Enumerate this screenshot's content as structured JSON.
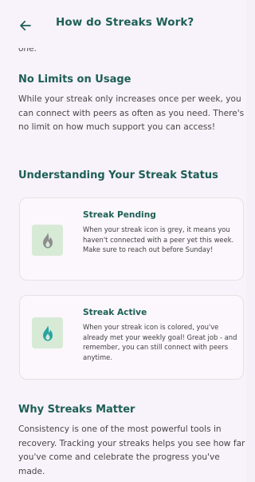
{
  "header": {
    "title": "How do Streaks Work?",
    "back_icon": "arrow-left-icon"
  },
  "content": {
    "cut_text": "one.",
    "sections": [
      {
        "title": "No Limits on Usage",
        "body": "While your streak only increases once per week, you can connect with peers as often as you need. There's no limit on how much support you can access!"
      },
      {
        "title": "Understanding Your Streak Status"
      },
      {
        "title": "Why Streaks Matter",
        "body": "Consistency is one of the most powerful tools in recovery. Tracking your streaks helps you see how far you've come and celebrate the progress you've made."
      }
    ],
    "cards": [
      {
        "title": "Streak Pending",
        "text": "When your streak icon is grey, it means you haven't connected with a peer yet this week. Make sure to reach out before Sunday!",
        "icon": "grey-flame-icon"
      },
      {
        "title": "Streak Active",
        "text": "When your streak icon is colored, you've already met your weekly goal! Great job - and remember, you can still connect with peers anytime.",
        "icon": "teal-flame-icon"
      }
    ]
  },
  "colors": {
    "accent": "#1d5f56",
    "background": "#f8f2fa",
    "icon_box": "#d7ead6",
    "flame_grey": "#8d8d8d",
    "flame_teal": "#2aa3a3"
  }
}
